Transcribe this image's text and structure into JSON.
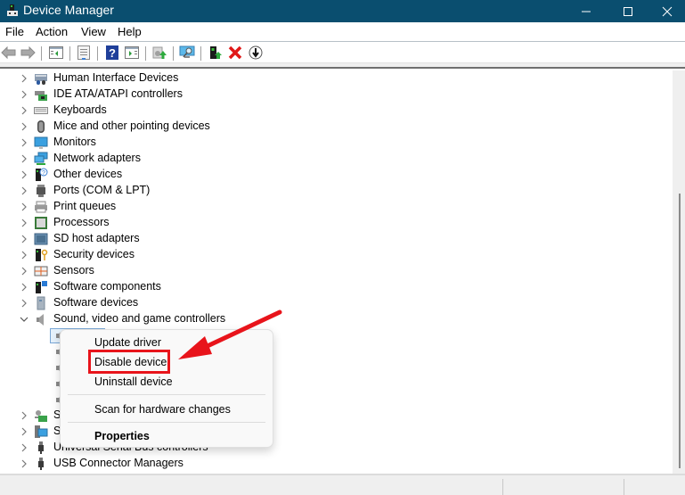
{
  "window": {
    "title": "Device Manager",
    "controls": {
      "minimize": "minimize",
      "maximize": "maximize",
      "close": "close"
    }
  },
  "menubar": {
    "items": [
      "File",
      "Action",
      "View",
      "Help"
    ]
  },
  "toolbar": {
    "buttons": [
      "back-icon",
      "forward-icon",
      "show-hide-console-tree-icon",
      "properties-icon",
      "help-icon",
      "show-action-pane-icon",
      "update-driver-icon",
      "scan-hardware-icon",
      "enable-device-icon",
      "uninstall-device-icon",
      "disable-device-icon"
    ]
  },
  "tree": {
    "categories": [
      {
        "label": "Human Interface Devices",
        "icon": "hid-icon",
        "expanded": false
      },
      {
        "label": "IDE ATA/ATAPI controllers",
        "icon": "ide-controller-icon",
        "expanded": false
      },
      {
        "label": "Keyboards",
        "icon": "keyboard-icon",
        "expanded": false
      },
      {
        "label": "Mice and other pointing devices",
        "icon": "mouse-icon",
        "expanded": false
      },
      {
        "label": "Monitors",
        "icon": "monitor-icon",
        "expanded": false
      },
      {
        "label": "Network adapters",
        "icon": "network-adapter-icon",
        "expanded": false
      },
      {
        "label": "Other devices",
        "icon": "other-devices-icon",
        "expanded": false
      },
      {
        "label": "Ports (COM & LPT)",
        "icon": "port-icon",
        "expanded": false
      },
      {
        "label": "Print queues",
        "icon": "printer-icon",
        "expanded": false
      },
      {
        "label": "Processors",
        "icon": "processor-icon",
        "expanded": false
      },
      {
        "label": "SD host adapters",
        "icon": "sd-adapter-icon",
        "expanded": false
      },
      {
        "label": "Security devices",
        "icon": "security-device-icon",
        "expanded": false
      },
      {
        "label": "Sensors",
        "icon": "sensor-icon",
        "expanded": false
      },
      {
        "label": "Software components",
        "icon": "software-component-icon",
        "expanded": false
      },
      {
        "label": "Software devices",
        "icon": "software-device-icon",
        "expanded": false
      },
      {
        "label": "Sound, video and game controllers",
        "icon": "speaker-icon",
        "expanded": true
      }
    ],
    "after_categories": [
      {
        "label": "St",
        "icon": "storage-controller-icon",
        "expanded": false
      },
      {
        "label": "Sy",
        "icon": "system-devices-icon",
        "expanded": false
      },
      {
        "label": "Universal Serial Bus controllers",
        "icon": "usb-icon",
        "expanded": false
      },
      {
        "label": "USB Connector Managers",
        "icon": "usb-icon",
        "expanded": false
      }
    ]
  },
  "context_menu": {
    "items": [
      {
        "label": "Update driver"
      },
      {
        "label": "Disable device",
        "highlighted": true
      },
      {
        "label": "Uninstall device"
      },
      {
        "label": "Scan for hardware changes"
      },
      {
        "label": "Properties",
        "bold": true
      }
    ]
  },
  "annotation": {
    "highlight_color": "#e8141b",
    "arrow_color": "#e8141b"
  },
  "colors": {
    "titlebar": "#0a4e6f",
    "selection": "#e5f1fb"
  }
}
